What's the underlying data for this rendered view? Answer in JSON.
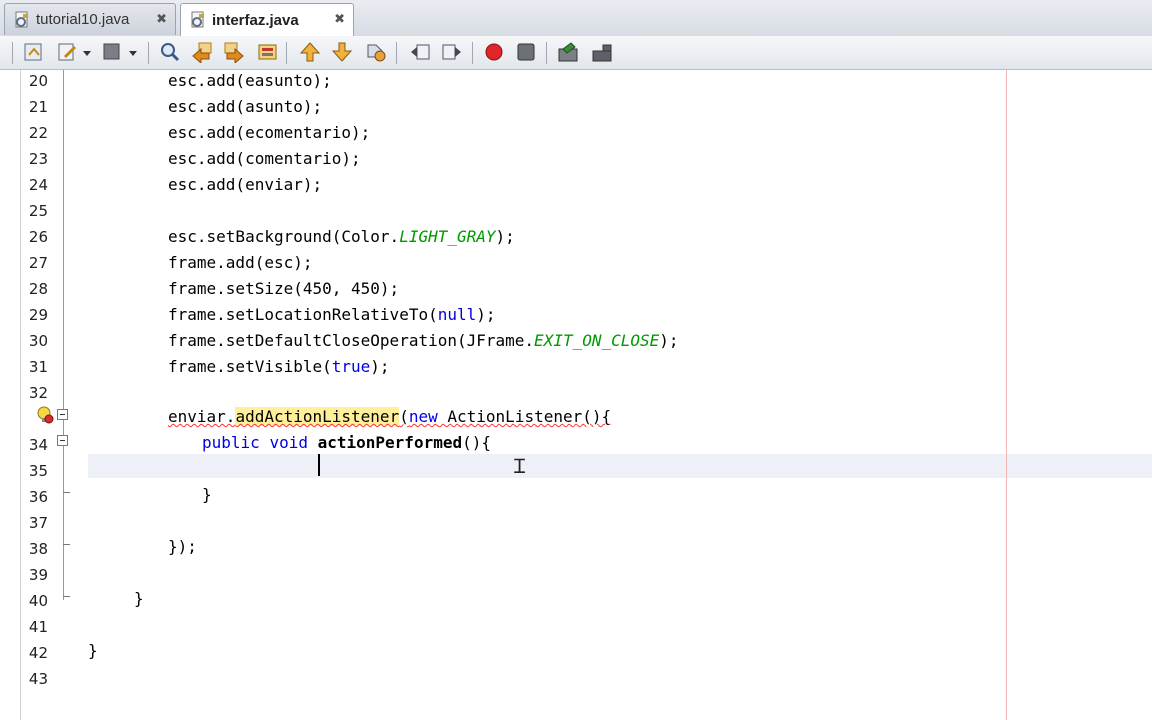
{
  "tabs": [
    {
      "label": "tutorial10.java",
      "active": false
    },
    {
      "label": "interfaz.java",
      "active": true
    }
  ],
  "tab_close_glyph": "✖",
  "toolbar_icons": [
    "go-to-source-icon",
    "last-edit-icon",
    "dropdown-arrow-icon",
    "toggle-bookmark-icon",
    "dropdown-arrow-icon",
    "find-icon",
    "find-previous-icon",
    "find-next-icon",
    "toggle-highlight-icon",
    "previous-bookmark-icon",
    "next-bookmark-icon",
    "toggle-bookmarks-icon",
    "shift-left-icon",
    "shift-right-icon",
    "start-macro-recording-icon",
    "stop-macro-recording-icon",
    "comment-icon",
    "uncomment-icon"
  ],
  "line_numbers": [
    "20",
    "21",
    "22",
    "23",
    "24",
    "25",
    "26",
    "27",
    "28",
    "29",
    "30",
    "31",
    "32",
    "",
    "34",
    "35",
    "36",
    "37",
    "38",
    "39",
    "40",
    "41",
    "42",
    "43"
  ],
  "code": {
    "l20": "esc.add(easunto);",
    "l21": "esc.add(asunto);",
    "l22": "esc.add(ecomentario);",
    "l23": "esc.add(comentario);",
    "l24": "esc.add(enviar);",
    "l26a": "esc.setBackground(Color.",
    "l26b": "LIGHT_GRAY",
    "l26c": ");",
    "l27": "frame.add(esc);",
    "l28": "frame.setSize(450, 450);",
    "l29a": "frame.setLocationRelativeTo(",
    "l29b": "null",
    "l29c": ");",
    "l30a": "frame.setDefaultCloseOperation(JFrame.",
    "l30b": "EXIT_ON_CLOSE",
    "l30c": ");",
    "l31a": "frame.setVisible(",
    "l31b": "true",
    "l31c": ");",
    "l33a": "enviar.",
    "l33b": "addActionListener",
    "l33c": "(",
    "l33d": "new",
    "l33e": " ActionListener(){",
    "l34a": "public",
    "l34b": " ",
    "l34c": "void",
    "l34d": " ",
    "l34e": "actionPerformed",
    "l34f": "(){",
    "l36": "}",
    "l38": "});",
    "l40": "}",
    "l42": "}"
  }
}
